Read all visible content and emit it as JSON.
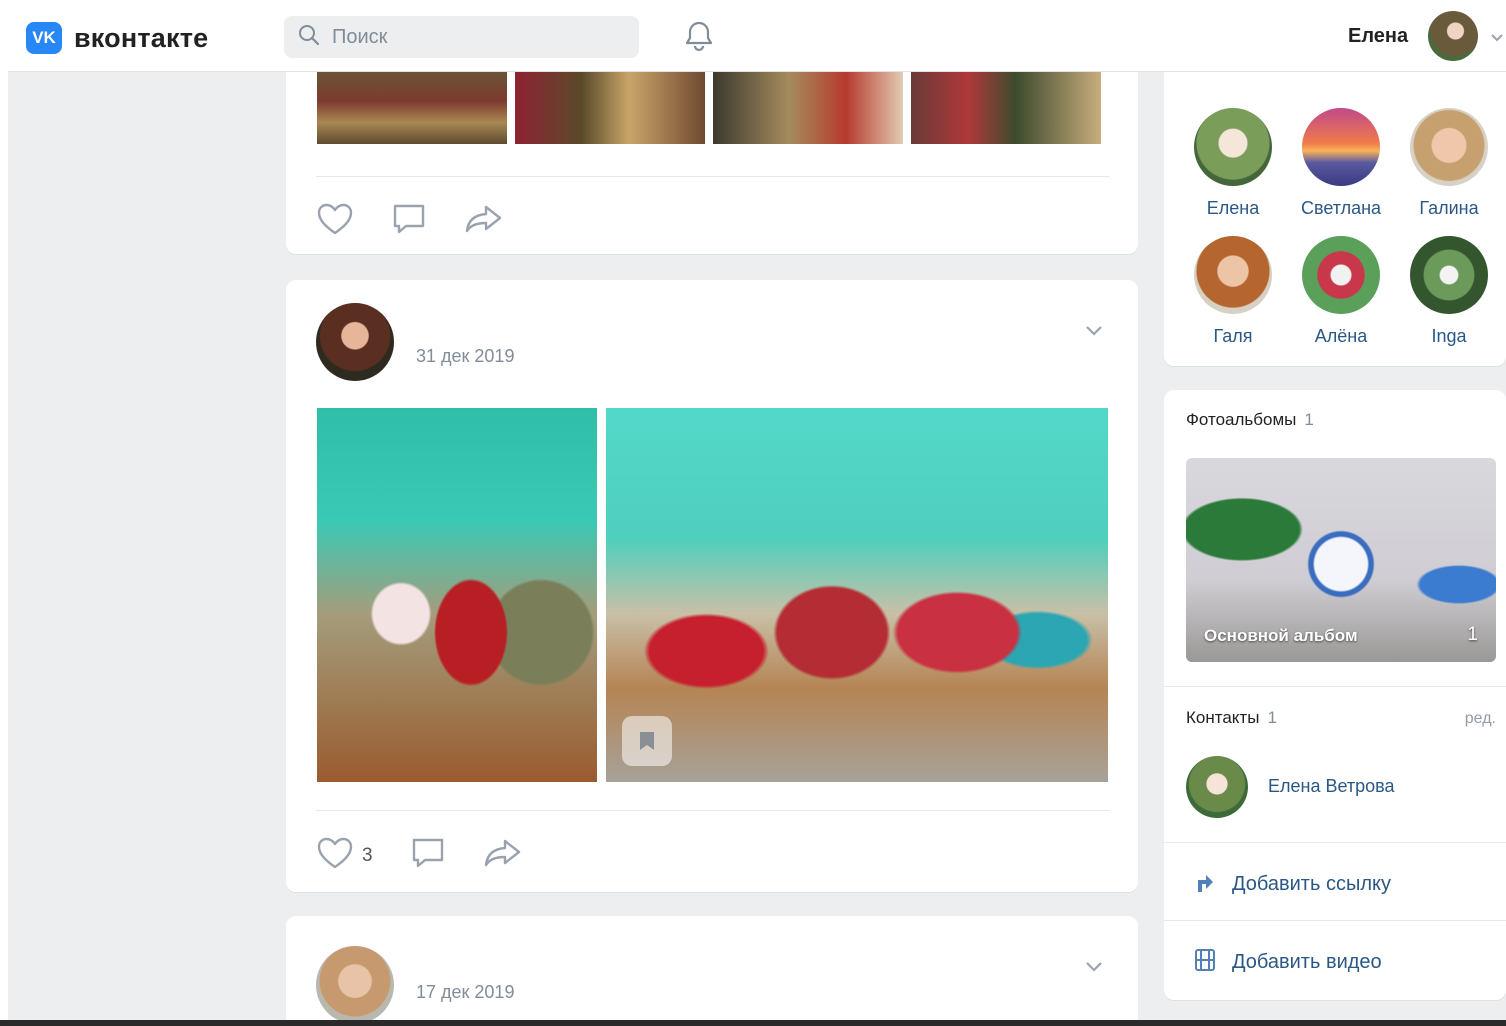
{
  "header": {
    "logo_mark": "VK",
    "logo_text": "вконтакте",
    "search_placeholder": "Поиск",
    "user_name": "Елена"
  },
  "posts": [
    {
      "likes": "",
      "date": ""
    },
    {
      "date": "31 дек 2019",
      "likes": "3"
    },
    {
      "date": "17 дек 2019"
    }
  ],
  "friends": [
    {
      "name": "Елена"
    },
    {
      "name": "Светлана"
    },
    {
      "name": "Галина"
    },
    {
      "name": "Галя"
    },
    {
      "name": "Алёна"
    },
    {
      "name": "Inga"
    }
  ],
  "albums": {
    "title": "Фотоальбомы",
    "count": "1",
    "album_name": "Основной альбом",
    "album_photo_count": "1"
  },
  "contacts": {
    "title": "Контакты",
    "count": "1",
    "edit_label": "ред.",
    "contact_name": "Елена Ветрова"
  },
  "side_actions": {
    "add_link": "Добавить ссылку",
    "add_video": "Добавить видео"
  },
  "colors": {
    "accent": "#2787f5",
    "link": "#2a5885",
    "muted": "#818c99",
    "background": "#edeef0"
  },
  "icons": [
    "search-icon",
    "bell-icon",
    "chevron-down-icon",
    "like-icon",
    "comment-icon",
    "share-icon",
    "bookmark-icon",
    "link-icon",
    "video-icon"
  ]
}
